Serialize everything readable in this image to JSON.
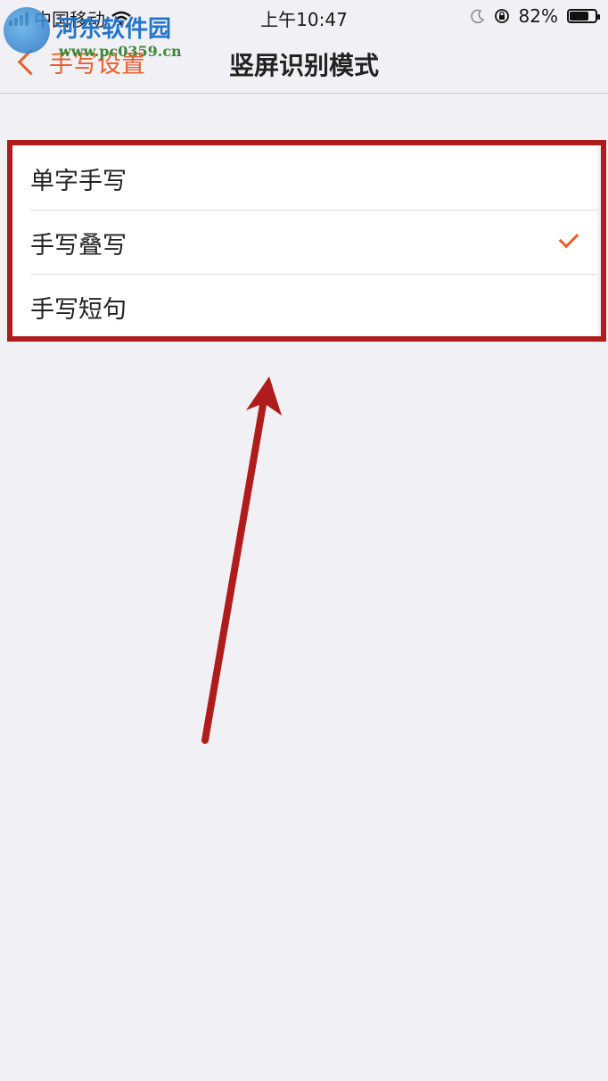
{
  "status_bar": {
    "carrier": "中国移动",
    "time": "上午10:47",
    "battery": "82%",
    "battery_level": 0.82
  },
  "watermark": {
    "title": "河东软件园",
    "url": "www.pc0359.cn"
  },
  "nav": {
    "back_label": "手写设置",
    "title": "竖屏识别模式"
  },
  "options": [
    {
      "label": "单字手写",
      "selected": false
    },
    {
      "label": "手写叠写",
      "selected": true
    },
    {
      "label": "手写短句",
      "selected": false
    }
  ],
  "colors": {
    "accent": "#e6602d",
    "annotation": "#b01c1c",
    "background": "#f1f0f4"
  }
}
